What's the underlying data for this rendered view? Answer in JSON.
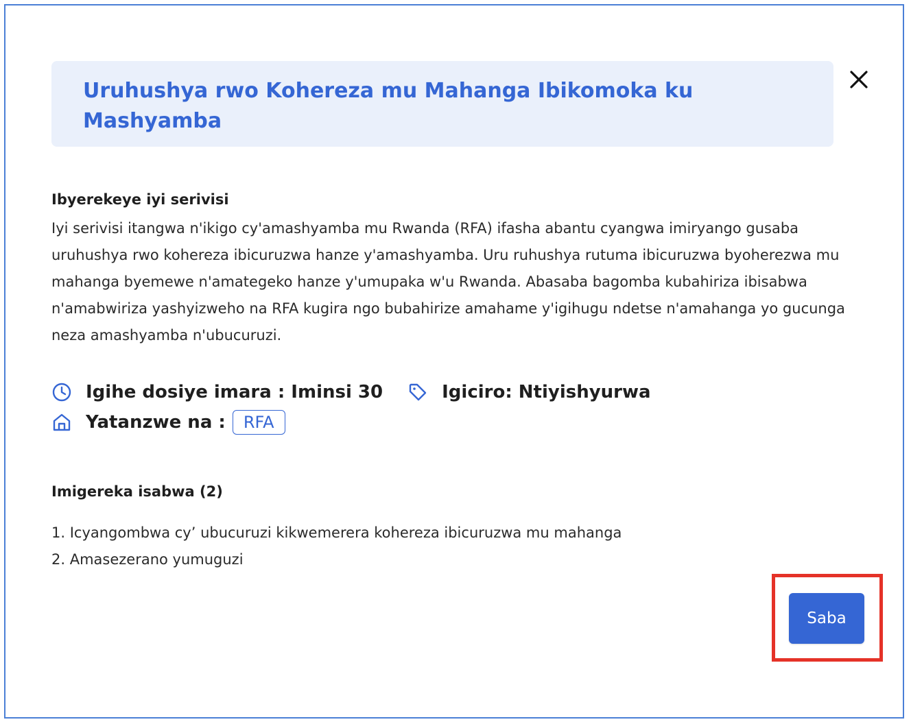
{
  "modal": {
    "title": "Uruhushya rwo Kohereza mu Mahanga Ibikomoka ku Mashyamba",
    "close_icon": "close-icon",
    "about": {
      "heading": "Ibyerekeye iyi serivisi",
      "body": "Iyi serivisi itangwa n'ikigo cy'amashyamba mu Rwanda (RFA) ifasha abantu cyangwa imiryango gusaba uruhushya rwo kohereza ibicuruzwa hanze y'amashyamba. Uru ruhushya rutuma ibicuruzwa byoherezwa mu mahanga byemewe n'amategeko hanze y'umupaka w'u Rwanda. Abasaba bagomba kubahiriza ibisabwa n'amabwiriza yashyizweho na RFA kugira ngo bubahirize amahame y'igihugu ndetse n'amahanga yo gucunga neza amashyamba n'ubucuruzi."
    },
    "meta": {
      "processing_time": "Igihe dosiye imara : Iminsi 30",
      "processing_time_icon": "clock-icon",
      "price": "Igiciro: Ntiyishyurwa",
      "price_icon": "tag-icon",
      "provider_label": "Yatanzwe na :",
      "provider_icon": "home-icon",
      "provider_badge": "RFA"
    },
    "documents": {
      "heading": "Imigereka isabwa (2)",
      "items": [
        "1. Icyangombwa cy’ ubucuruzi kikwemerera kohereza ibicuruzwa mu mahanga",
        "2. Amasezerano yumuguzi"
      ]
    },
    "apply_button": "Saba"
  },
  "colors": {
    "accent": "#3566d4",
    "title_background": "#eaf0fb",
    "modal_border": "#4a7fd6",
    "highlight": "#e53228"
  }
}
